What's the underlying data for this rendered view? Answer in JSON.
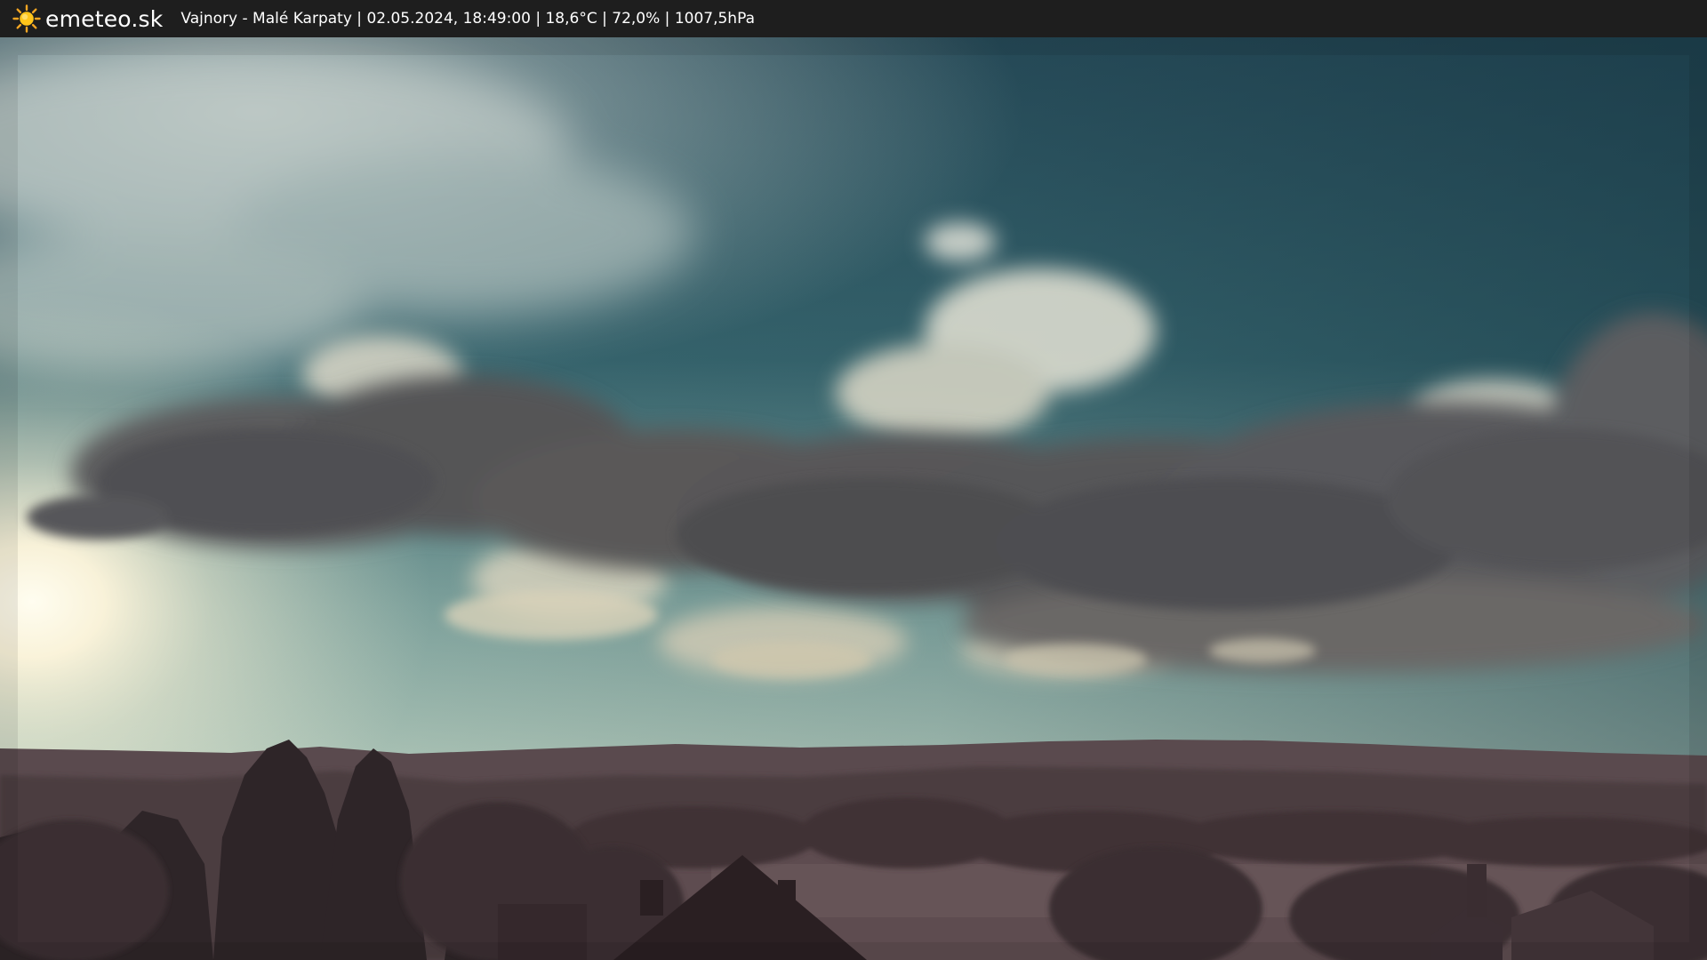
{
  "header": {
    "brand": "emeteo.sk",
    "logo_icon": "sun-icon",
    "station": "Vajnory - Malé Karpaty",
    "separator": " | ",
    "datetime": "02.05.2024, 18:49:00",
    "temperature": "18,6°C",
    "humidity": "72,0%",
    "pressure": "1007,5hPa"
  },
  "colors": {
    "bar_background": "#1e1e1e",
    "sun_glow": "#fff3cf",
    "sky_upper": "#2d5665",
    "sky_lower": "#a9c6b9",
    "clouds_dark": "#58575a",
    "hills": "#55454a",
    "foreground": "#3d2f34"
  },
  "webcam": {
    "scene": "sky-clouds-hills-village"
  }
}
